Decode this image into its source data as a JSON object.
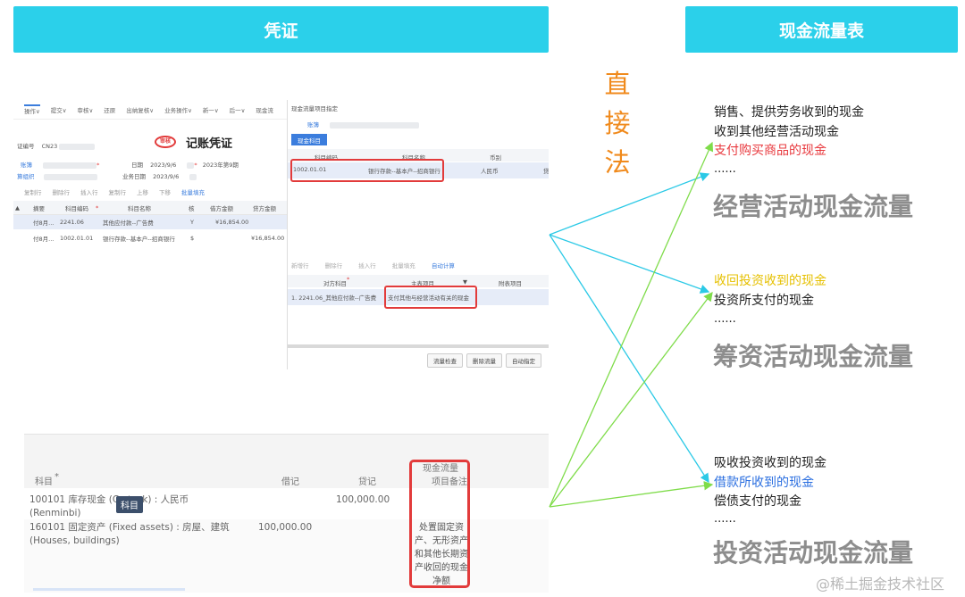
{
  "banners": {
    "voucher": "凭证",
    "cashflow": "现金流量表"
  },
  "method_label": [
    "直",
    "接",
    "法"
  ],
  "voucher_ui": {
    "menu": [
      "操作∨",
      "提交∨",
      "审核∨",
      "还原",
      "出纳复核∨",
      "业务操作∨",
      "新一∨",
      "后一∨",
      "现金流"
    ],
    "voucher_code_label": "证编号",
    "voucher_code_value": "CN23",
    "stamp": "审核",
    "title": "记账凭证",
    "ledger_label": "账簿",
    "org_label": "算组织",
    "date_label": "日期",
    "date_value": "2023/9/6",
    "period_value": "2023年第9期",
    "biz_date_label": "业务日期",
    "biz_date_value": "2023/9/6",
    "toolbar": [
      "复制行",
      "删除行",
      "插入行",
      "复制行",
      "上移",
      "下移",
      "批量填充"
    ],
    "table_headers": [
      "摘要",
      "科目编码",
      "科目名称",
      "核",
      "借方金额",
      "贷方金额"
    ],
    "rows": [
      {
        "summary": "付8月...",
        "code": "2241.06",
        "name": "其他应付款--广告费",
        "check": "Y",
        "debit": "¥16,854.00",
        "credit": ""
      },
      {
        "summary": "付8月...",
        "code": "1002.01.01",
        "name": "银行存款--基本户--招商银行",
        "check": "$",
        "debit": "",
        "credit": "¥16,854.00"
      }
    ]
  },
  "cash_popup": {
    "title": "现金流量项目指定",
    "ledger_label": "账簿",
    "tab": "现金科目",
    "headers": [
      "科目编码",
      "科目名称",
      "币别",
      "贷"
    ],
    "row": {
      "code": "1002.01.01",
      "name": "银行存款--基本户--招商银行",
      "currency": "人民币",
      "flag": "贷"
    },
    "toolbar": [
      "新增行",
      "删除行",
      "插入行",
      "批量填充",
      "自动计算"
    ],
    "headers2": [
      "对方科目",
      "主表项目",
      "附表项目"
    ],
    "row2": {
      "counter": "1. 2241.06_其他应付款--广告费",
      "main": "支付其他与经营活动有关的现金",
      "sub": ""
    },
    "buttons": [
      "流量检查",
      "删除流量",
      "自动指定"
    ]
  },
  "bottom_ui": {
    "headers": {
      "subject": "科目",
      "debit": "借记",
      "credit": "贷记",
      "cashflow": "现金流量项目",
      "remark": "备注"
    },
    "row1": {
      "subject": "100101 库存现金 (Ca      tock) : 人民币 (Renminbi)",
      "credit": "100,000.00"
    },
    "row2": {
      "subject": "160101 固定资产 (Fixed assets) : 房屋、建筑 (Houses, buildings)",
      "debit": "100,000.00",
      "cashflow": "处置固定资产、无形资产和其他长期资产收回的现金净额"
    },
    "tooltip": "科目"
  },
  "cashflow_statement": {
    "operating": {
      "items": [
        "销售、提供劳务收到的现金",
        "收到其他经营活动现金",
        "支付购买商品的现金"
      ],
      "dots": "......",
      "total": "经营活动现金流量"
    },
    "financing": {
      "items": [
        "收回投资收到的现金",
        "投资所支付的现金"
      ],
      "dots": "......",
      "total": "筹资活动现金流量"
    },
    "investing": {
      "items": [
        "吸收投资收到的现金",
        "借款所收到的现金",
        "偿债支付的现金"
      ],
      "dots": "......",
      "total": "投资活动现金流量"
    }
  },
  "colors": {
    "banner": "#2bd0ea",
    "method": "#f08a1c",
    "red": "#e8383d",
    "yellow": "#e6c000",
    "blue": "#2b6fe0",
    "arrow_cyan": "#2bc9e6",
    "arrow_green": "#7fdc4a"
  },
  "watermark": "@稀土掘金技术社区"
}
